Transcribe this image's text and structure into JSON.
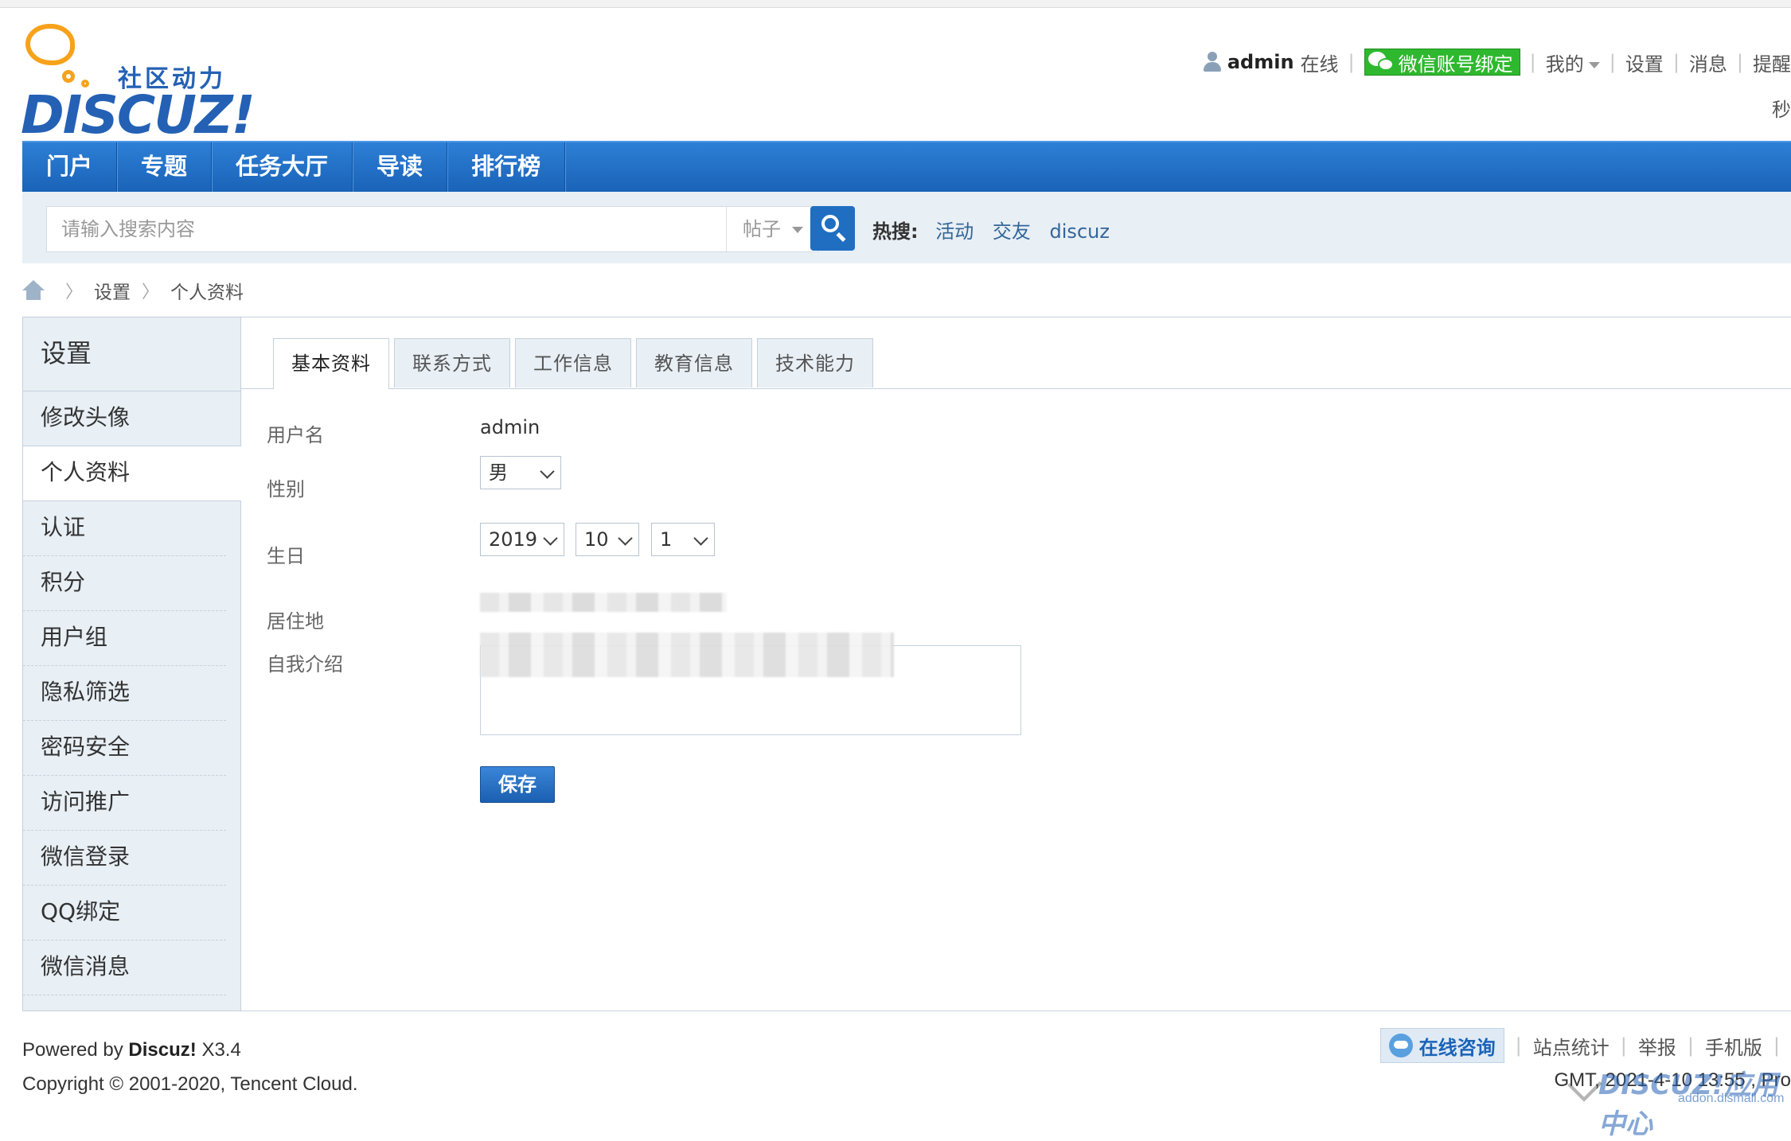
{
  "header": {
    "logo_slogan": "社区动力",
    "logo_brand": "DISCUZ!",
    "user": {
      "username": "admin",
      "status": "在线",
      "wechat_bind_label": "微信账号绑定",
      "menu": [
        "我的",
        "设置",
        "消息",
        "提醒"
      ],
      "line2_fragment": "秒"
    }
  },
  "nav": {
    "items": [
      "门户",
      "专题",
      "任务大厅",
      "导读",
      "排行榜"
    ]
  },
  "search": {
    "placeholder": "请输入搜索内容",
    "type_selected": "帖子",
    "hot_label": "热搜:",
    "hot_links": [
      "活动",
      "交友",
      "discuz"
    ]
  },
  "breadcrumb": [
    "设置",
    "个人资料"
  ],
  "sidebar": {
    "title": "设置",
    "items": [
      "修改头像",
      "个人资料",
      "认证",
      "积分",
      "用户组",
      "隐私筛选",
      "密码安全",
      "访问推广",
      "微信登录",
      "QQ绑定",
      "微信消息"
    ],
    "active_index": 1
  },
  "tabs": [
    "基本资料",
    "联系方式",
    "工作信息",
    "教育信息",
    "技术能力"
  ],
  "form": {
    "username_label": "用户名",
    "username_value": "admin",
    "gender_label": "性别",
    "gender_value": "男",
    "birthday_label": "生日",
    "birth_year": "2019",
    "birth_month": "10",
    "birth_day": "1",
    "residence_label": "居住地",
    "bio_label": "自我介绍",
    "save_label": "保存"
  },
  "footer": {
    "powered_prefix": "Powered by",
    "powered_brand": "Discuz!",
    "powered_version": "X3.4",
    "copyright": "Copyright © 2001-2020, Tencent Cloud.",
    "consult_label": "在线咨询",
    "links": [
      "站点统计",
      "举报",
      "手机版"
    ],
    "line2_fragment": "GMT, 2021-4-10 13:55 , Pro",
    "watermark_brand": "DISCUZ!应用中心",
    "watermark_site": "addon.dismall.com"
  }
}
